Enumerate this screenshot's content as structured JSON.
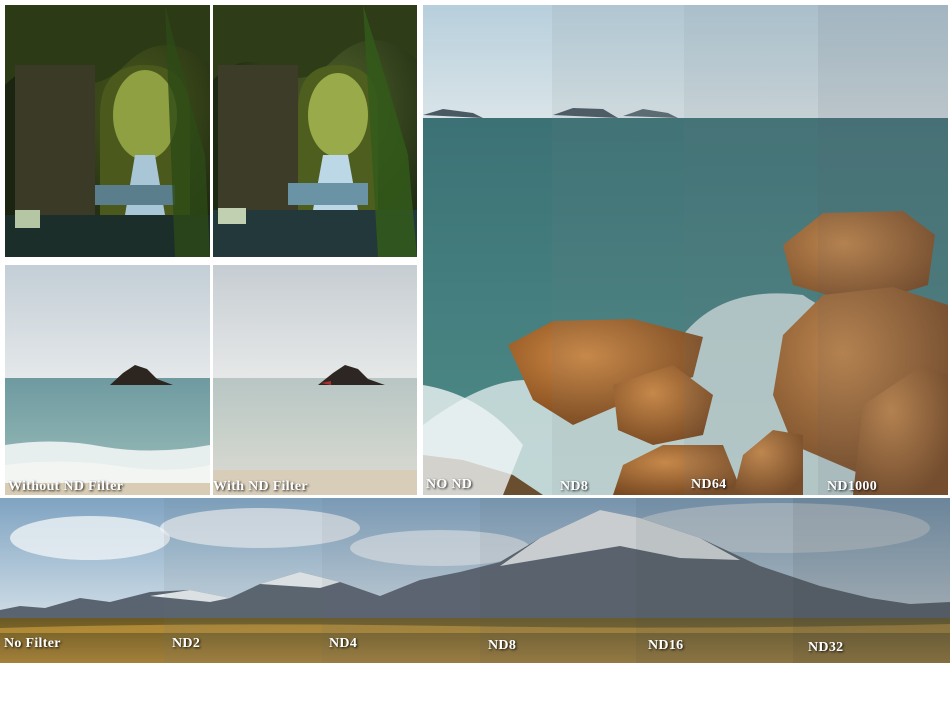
{
  "comparison_tunnel": {
    "left_alt": "Waterfall in stone tunnel without ND filter",
    "right_alt": "Waterfall in stone tunnel with ND filter"
  },
  "comparison_sea_rock": {
    "left_label": "Without ND Filter",
    "right_label": "With ND Filter"
  },
  "coast_strip": {
    "labels": [
      "NO ND",
      "ND8",
      "ND64",
      "ND1000"
    ]
  },
  "mountain_strip": {
    "labels": [
      "No Filter",
      "ND2",
      "ND4",
      "ND8",
      "ND16",
      "ND32"
    ]
  },
  "colors": {
    "sky_light": "#c9d6df",
    "sea": "#3f7f7e",
    "rock": "#b06a2f",
    "foliage": "#2f4a1c",
    "field": "#8a6a2a",
    "snow": "#e8ecef"
  }
}
